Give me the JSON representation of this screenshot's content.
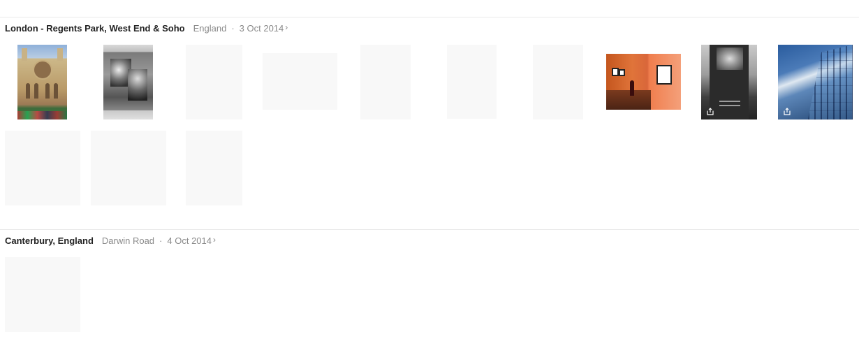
{
  "moments": [
    {
      "title": "London - Regents Park, West End & Soho",
      "location": "England",
      "separator": "·",
      "date": "3 Oct 2014",
      "chevron": "›"
    },
    {
      "title": "Canterbury, England",
      "location": "Darwin Road",
      "separator": "·",
      "date": "4 Oct 2014",
      "chevron": "›"
    }
  ],
  "icons": {
    "share": "share-icon"
  },
  "colors": {
    "placeholder": "#f8f8f8",
    "divider": "#e9e9e9",
    "title": "#222222",
    "meta": "#8a8a8a"
  }
}
